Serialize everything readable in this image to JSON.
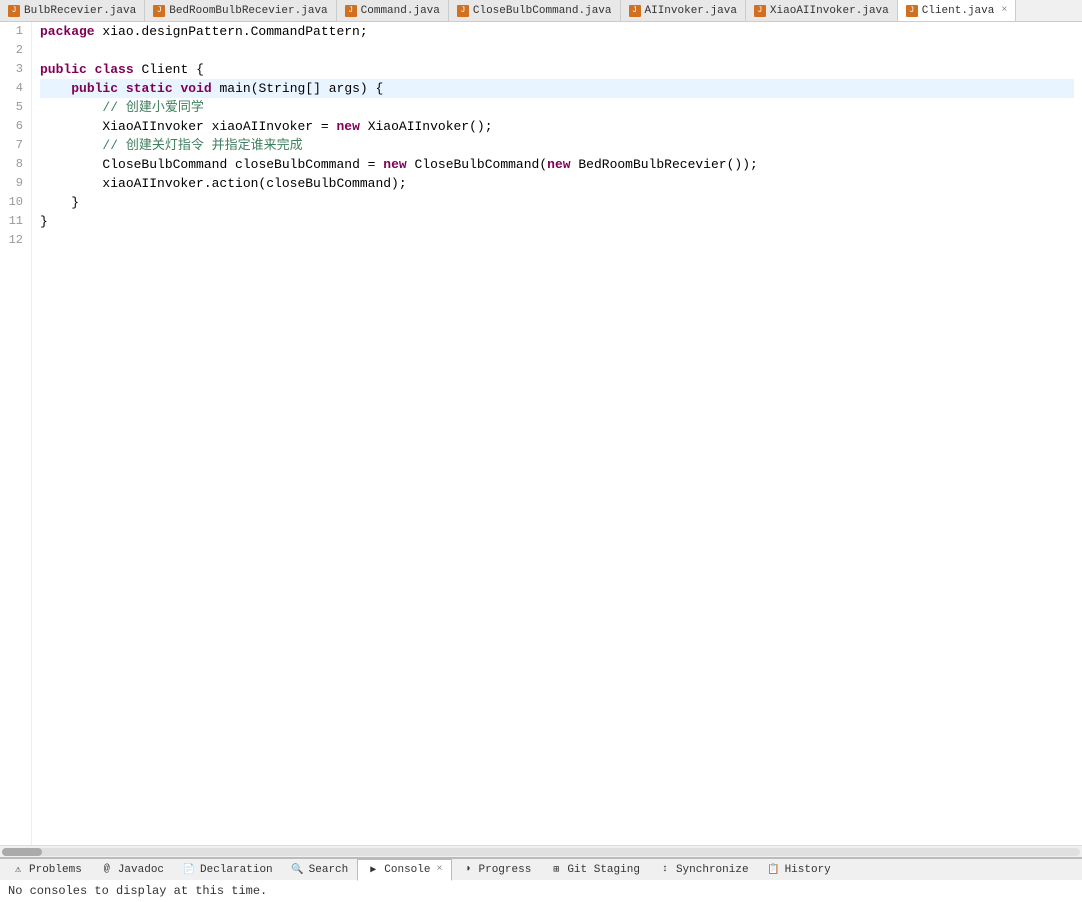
{
  "tabs": [
    {
      "id": "bulb-recevier",
      "label": "BulbRecevier.java",
      "icon": "J",
      "active": false,
      "closable": false
    },
    {
      "id": "bedroom-bulb-recevier",
      "label": "BedRoomBulbRecevier.java",
      "icon": "J",
      "active": false,
      "closable": false
    },
    {
      "id": "command",
      "label": "Command.java",
      "icon": "J",
      "active": false,
      "closable": false
    },
    {
      "id": "close-bulb-command",
      "label": "CloseBulbCommand.java",
      "icon": "J",
      "active": false,
      "closable": false
    },
    {
      "id": "ai-invoker",
      "label": "AIInvoker.java",
      "icon": "J",
      "active": false,
      "closable": false
    },
    {
      "id": "xiao-ai-invoker",
      "label": "XiaoAIInvoker.java",
      "icon": "J",
      "active": false,
      "closable": false
    },
    {
      "id": "client",
      "label": "Client.java",
      "icon": "J",
      "active": true,
      "closable": true
    }
  ],
  "code": {
    "lines": [
      {
        "num": "1",
        "content": "package xiao.designPattern.CommandPattern;",
        "highlighted": false
      },
      {
        "num": "2",
        "content": "",
        "highlighted": false
      },
      {
        "num": "3",
        "content": "public class Client {",
        "highlighted": false
      },
      {
        "num": "4",
        "content": "    public static void main(String[] args) {",
        "highlighted": true
      },
      {
        "num": "5",
        "content": "        // 创建小爱同学",
        "highlighted": false
      },
      {
        "num": "6",
        "content": "        XiaoAIInvoker xiaoAIInvoker = new XiaoAIInvoker();",
        "highlighted": false
      },
      {
        "num": "7",
        "content": "        // 创建关灯指令 并指定谁来完成",
        "highlighted": false
      },
      {
        "num": "8",
        "content": "        CloseBulbCommand closeBulbCommand = new CloseBulbCommand(new BedRoomBulbRecevier());",
        "highlighted": false
      },
      {
        "num": "9",
        "content": "        xiaoAIInvoker.action(closeBulbCommand);",
        "highlighted": false
      },
      {
        "num": "10",
        "content": "    }",
        "highlighted": false
      },
      {
        "num": "11",
        "content": "}",
        "highlighted": false
      },
      {
        "num": "12",
        "content": "",
        "highlighted": false
      }
    ]
  },
  "bottom_tabs": [
    {
      "id": "problems",
      "label": "Problems",
      "icon": "⚠",
      "active": false,
      "closable": false
    },
    {
      "id": "javadoc",
      "label": "Javadoc",
      "icon": "@",
      "active": false,
      "closable": false
    },
    {
      "id": "declaration",
      "label": "Declaration",
      "icon": "📄",
      "active": false,
      "closable": false
    },
    {
      "id": "search",
      "label": "Search",
      "icon": "🔍",
      "active": false,
      "closable": false
    },
    {
      "id": "console",
      "label": "Console",
      "icon": "▶",
      "active": true,
      "closable": true
    },
    {
      "id": "progress",
      "label": "Progress",
      "icon": "◑",
      "active": false,
      "closable": false
    },
    {
      "id": "git-staging",
      "label": "Git Staging",
      "icon": "⊞",
      "active": false,
      "closable": false
    },
    {
      "id": "synchronize",
      "label": "Synchronize",
      "icon": "↕",
      "active": false,
      "closable": false
    },
    {
      "id": "history",
      "label": "History",
      "icon": "📋",
      "active": false,
      "closable": false
    }
  ],
  "console_message": "No consoles to display at this time."
}
